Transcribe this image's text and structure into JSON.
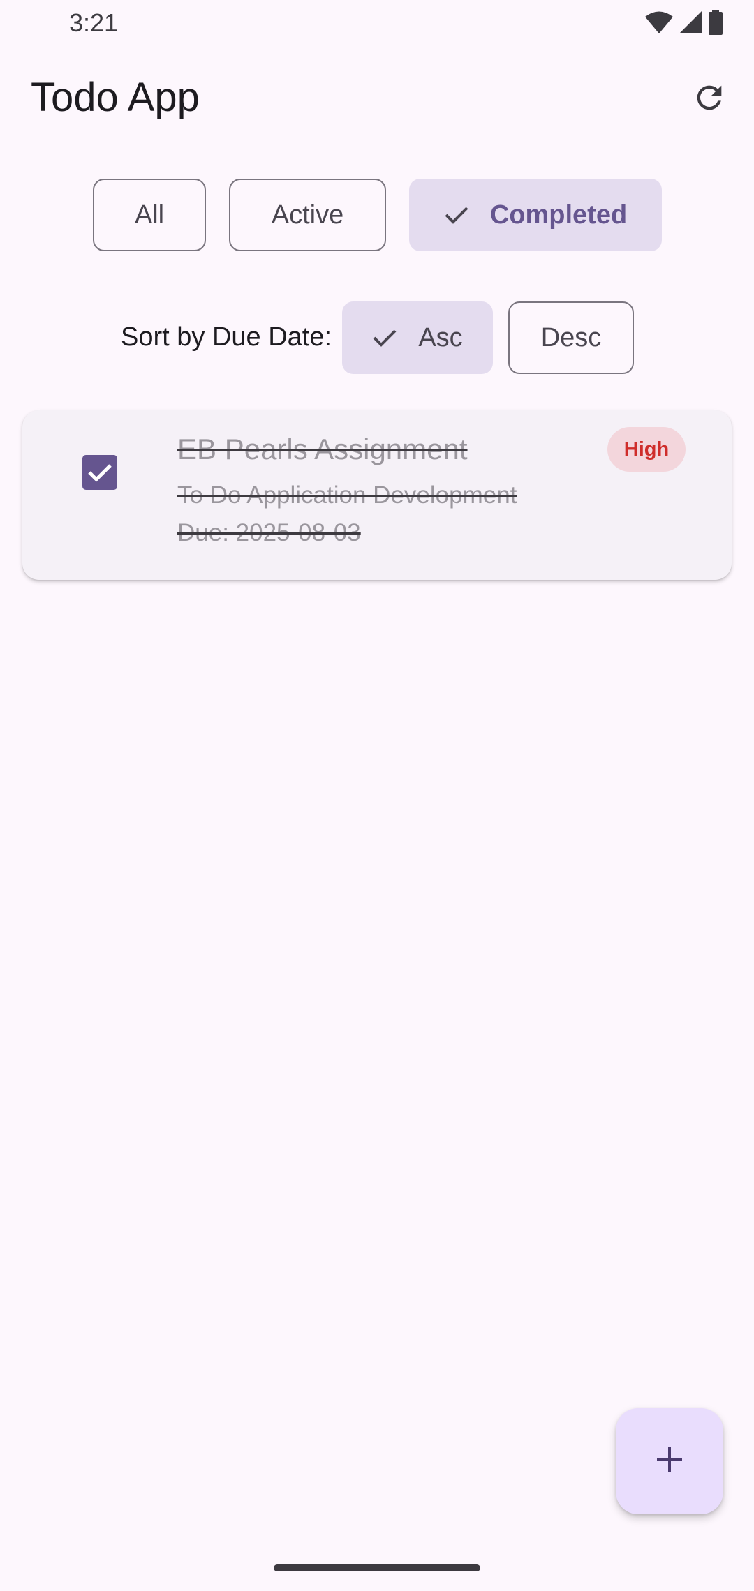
{
  "status_bar": {
    "time": "3:21"
  },
  "app_bar": {
    "title": "Todo App",
    "refresh_icon": "refresh-icon"
  },
  "filters": {
    "all": "All",
    "active": "Active",
    "completed": "Completed",
    "selected": "Completed"
  },
  "sort": {
    "label": "Sort by Due Date:",
    "asc": "Asc",
    "desc": "Desc",
    "selected": "Asc"
  },
  "tasks": [
    {
      "title": "EB Pearls Assignment",
      "description": "To Do Application Development",
      "due": "Due: 2025-08-03",
      "priority": "High",
      "completed": true
    }
  ],
  "colors": {
    "background": "#fdf7fd",
    "accent": "#65558f",
    "chip_selected": "#e4dcef",
    "card": "#f5f1f7",
    "priority_high_bg": "#f3d6dc",
    "priority_high_text": "#cf2d2b",
    "fab": "#e9ddfd"
  }
}
